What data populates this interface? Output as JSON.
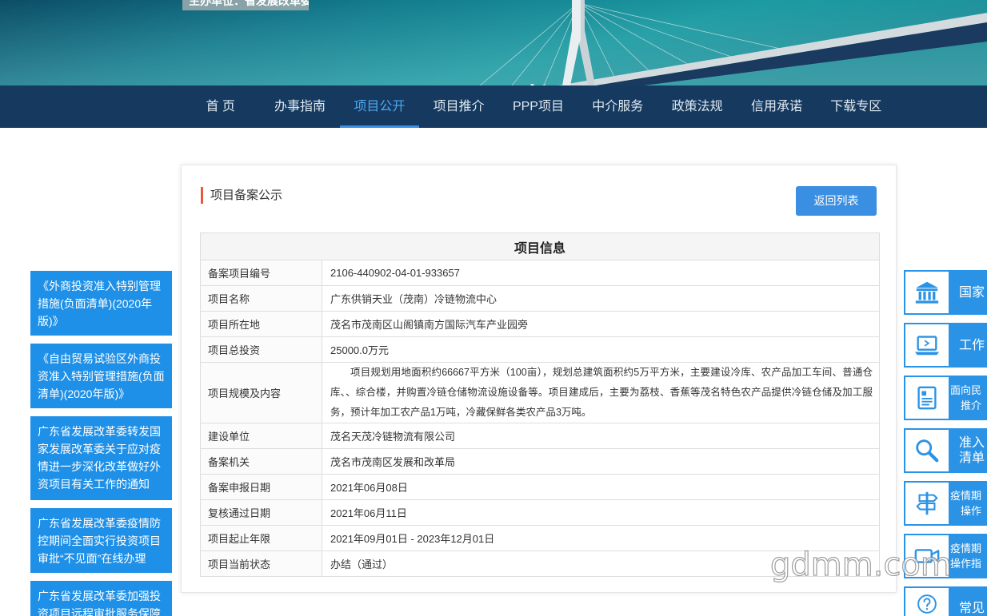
{
  "banner": {
    "caption": "主办单位：省发展改革委"
  },
  "nav": {
    "items": [
      {
        "label": "首 页",
        "active": false
      },
      {
        "label": "办事指南",
        "active": false
      },
      {
        "label": "项目公开",
        "active": true
      },
      {
        "label": "项目推介",
        "active": false
      },
      {
        "label": "PPP项目",
        "active": false
      },
      {
        "label": "中介服务",
        "active": false
      },
      {
        "label": "政策法规",
        "active": false
      },
      {
        "label": "信用承诺",
        "active": false
      },
      {
        "label": "下载专区",
        "active": false
      }
    ]
  },
  "card": {
    "title": "项目备案公示",
    "back_button": "返回列表"
  },
  "table": {
    "header": "项目信息",
    "rows": [
      {
        "label": "备案项目编号",
        "value": "2106-440902-04-01-933657"
      },
      {
        "label": "项目名称",
        "value": "广东供销天业（茂南）冷链物流中心"
      },
      {
        "label": "项目所在地",
        "value": "茂名市茂南区山阁镇南方国际汽车产业园旁"
      },
      {
        "label": "项目总投资",
        "value": "25000.0万元"
      },
      {
        "label": "项目规模及内容",
        "value": "项目规划用地面积约66667平方米（100亩），规划总建筑面积约5万平方米，主要建设冷库、农产品加工车间、普通仓库、、综合楼，并购置冷链仓储物流设施设备等。项目建成后，主要为荔枝、香蕉等茂名特色农产品提供冷链仓储及加工服务，预计年加工农产品1万吨，冷藏保鲜各类农产品3万吨。"
      },
      {
        "label": "建设单位",
        "value": "茂名天茂冷链物流有限公司"
      },
      {
        "label": "备案机关",
        "value": "茂名市茂南区发展和改革局"
      },
      {
        "label": "备案申报日期",
        "value": "2021年06月08日"
      },
      {
        "label": "复核通过日期",
        "value": "2021年06月11日"
      },
      {
        "label": "项目起止年限",
        "value": "2021年09月01日 - 2023年12月01日"
      },
      {
        "label": "项目当前状态",
        "value": "办结（通过）"
      }
    ]
  },
  "left_sidebar": {
    "items": [
      "《外商投资准入特别管理措施(负面清单)(2020年版)》",
      "《自由贸易试验区外商投资准入特别管理措施(负面清单)(2020年版)》",
      "广东省发展改革委转发国家发展改革委关于应对疫情进一步深化改革做好外资项目有关工作的通知",
      "广东省发展改革委疫情防控期间全面实行投资项目审批“不见面”在线办理",
      "广东省发展改革委加强投资项目远程审批服务保障"
    ]
  },
  "right_sidebar": {
    "items": [
      {
        "icon": "bank-icon",
        "lines": [
          "国家"
        ]
      },
      {
        "icon": "laptop-icon",
        "lines": [
          "工作"
        ]
      },
      {
        "icon": "document-icon",
        "lines": [
          "面向民",
          "推介"
        ]
      },
      {
        "icon": "search-icon",
        "lines": [
          "准入",
          "清单"
        ]
      },
      {
        "icon": "signpost-icon",
        "lines": [
          "疫情期",
          "操作"
        ]
      },
      {
        "icon": "video-camera-icon",
        "lines": [
          "疫情期",
          "操作指"
        ]
      },
      {
        "icon": "question-icon",
        "lines": [
          "常见"
        ]
      }
    ]
  },
  "watermark": "gdmm.com",
  "colors": {
    "nav_bg": "#163a5f",
    "nav_text": "#dfe8f0",
    "nav_active": "#4ea8f2",
    "accent_blue": "#3a8fe2",
    "sidebar_blue": "#1f90e7",
    "quick_blue": "#2b93e6",
    "title_bar": "#e45a3a"
  }
}
